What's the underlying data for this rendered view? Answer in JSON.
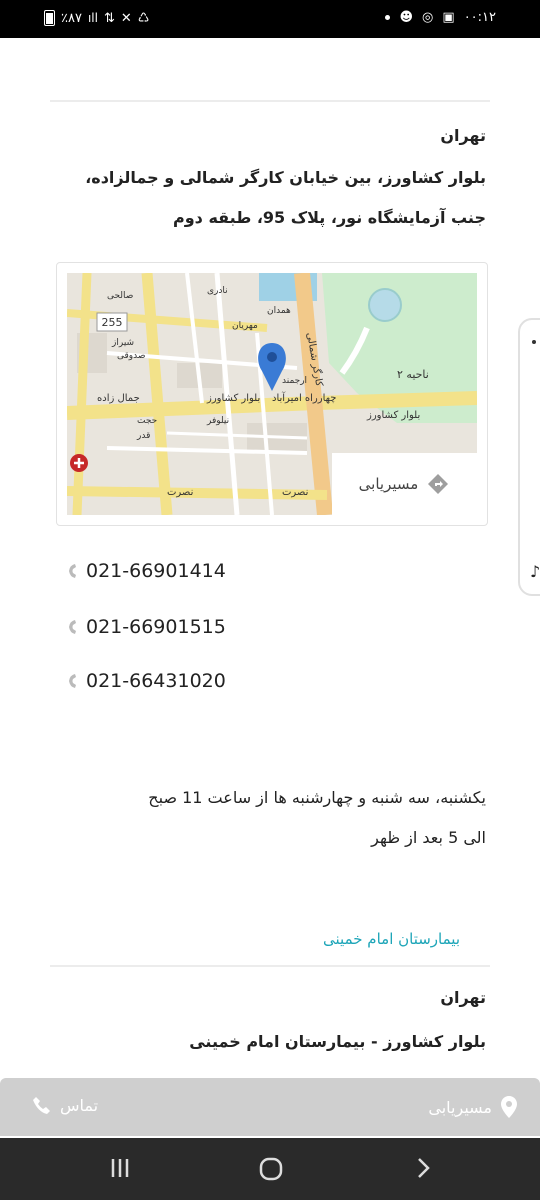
{
  "status_bar": {
    "time": "۰۰:۱۲",
    "battery": "٪۸۷",
    "signal": "ıll"
  },
  "location1": {
    "city": "تهران",
    "address_line1": "بلوار کشاورز، بین خیابان کارگر شمالی و جمالزاده،",
    "address_line2": "جنب آزمایشگاه نور، پلاک 95، طبقه دوم",
    "map_routing_label": "مسیریابی",
    "map_labels": {
      "road_number": "255",
      "blvd": "بلوار کشاورز",
      "square": "چهارراه امیرآباد",
      "district": "ناحیه ۲",
      "karegar": "کارگر شمالی",
      "jamalzadeh": "جمال زاده",
      "nosrat": "نصرت",
      "hejat": "حجت",
      "ghadr": "قدر",
      "sadooghi": "صدوقی",
      "mehrian": "مهریان",
      "niloufar": "نیلوفر",
      "salehi": "صالحی",
      "naderi": "نادری",
      "hamedan": "همدان",
      "arjmand": "ارجمند",
      "shiraz": "شیراز"
    },
    "phones": [
      "021-66901414",
      "021-66901515",
      "021-66431020"
    ],
    "hours_line1": "یکشنبه، سه شنبه و چهارشنبه ها از ساعت 11 صبح",
    "hours_line2": "الی 5 بعد از ظهر",
    "link_text": "بیمارستان امام خمینی"
  },
  "location2": {
    "city": "تهران",
    "address": "بلوار کشاورز - بیمارستان امام خمینی"
  },
  "bottom_bar": {
    "routing_label": "مسیریابی",
    "call_label": "تماس"
  },
  "colors": {
    "link": "#1da5b8",
    "map_pin": "#3a7bd5",
    "bottom_bar": "#cfcfcf"
  }
}
